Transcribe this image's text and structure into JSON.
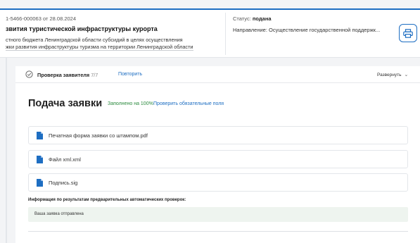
{
  "header": {
    "app_id": "1-5466-000063 от 28.08.2024",
    "title": "звития туристической инфраструктуры курорта",
    "desc_line1": "стного бюджета Ленинградской области субсидий в целях осуществления",
    "desc_line2": "жки развития инфраструктуры туризма на территории Ленинградской области",
    "status_label": "Статус:",
    "status_value": "подана",
    "direction": "Направление: Осуществление государственной поддержк..."
  },
  "icons": {
    "print": "printer-icon",
    "check": "check-circle-icon",
    "file": "document-icon",
    "expand": "chevron-down-icon"
  },
  "check_bar": {
    "label": "Проверка заявителя",
    "count": "7/7",
    "retry": "Повторить",
    "expand": "Развернуть"
  },
  "card": {
    "title": "Подача заявки",
    "filled": "Заполнено на 100%",
    "check_fields": "Проверить обязательные поля",
    "files": [
      {
        "name": "Печатная форма заявки со штампом.pdf"
      },
      {
        "name": "Файл xml.xml"
      },
      {
        "name": "Подпись.sig"
      }
    ],
    "info_label": "Информация по результатам предварительных автоматических проверок:",
    "info_text": "Ваша заявка отправлена"
  },
  "colors": {
    "accent": "#1e6ec2",
    "success": "#2b8a3e",
    "info_bg": "#eef4ef"
  }
}
